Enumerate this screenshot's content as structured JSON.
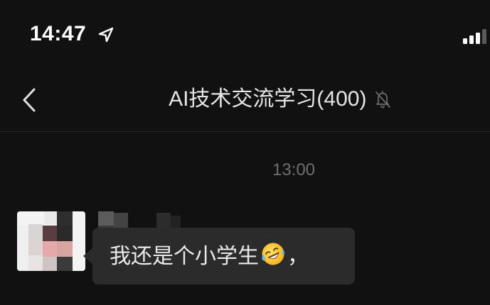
{
  "status_bar": {
    "time": "14:47",
    "location_icon": "location-arrow-icon",
    "signal_icon": "cellular-signal-icon"
  },
  "nav": {
    "back_icon": "chevron-left-icon",
    "title": "AI技术交流学习(400)",
    "mute_icon": "bell-slash-icon"
  },
  "chat": {
    "timestamp": "13:00",
    "messages": [
      {
        "text": "我还是个小学生",
        "emoji": "rolling-on-floor-laughing-emoji",
        "trailing": "，"
      }
    ]
  },
  "colors": {
    "background": "#111111",
    "bubble": "#2b2b2b",
    "text": "#eaeaea",
    "muted": "#6e6e6e"
  }
}
